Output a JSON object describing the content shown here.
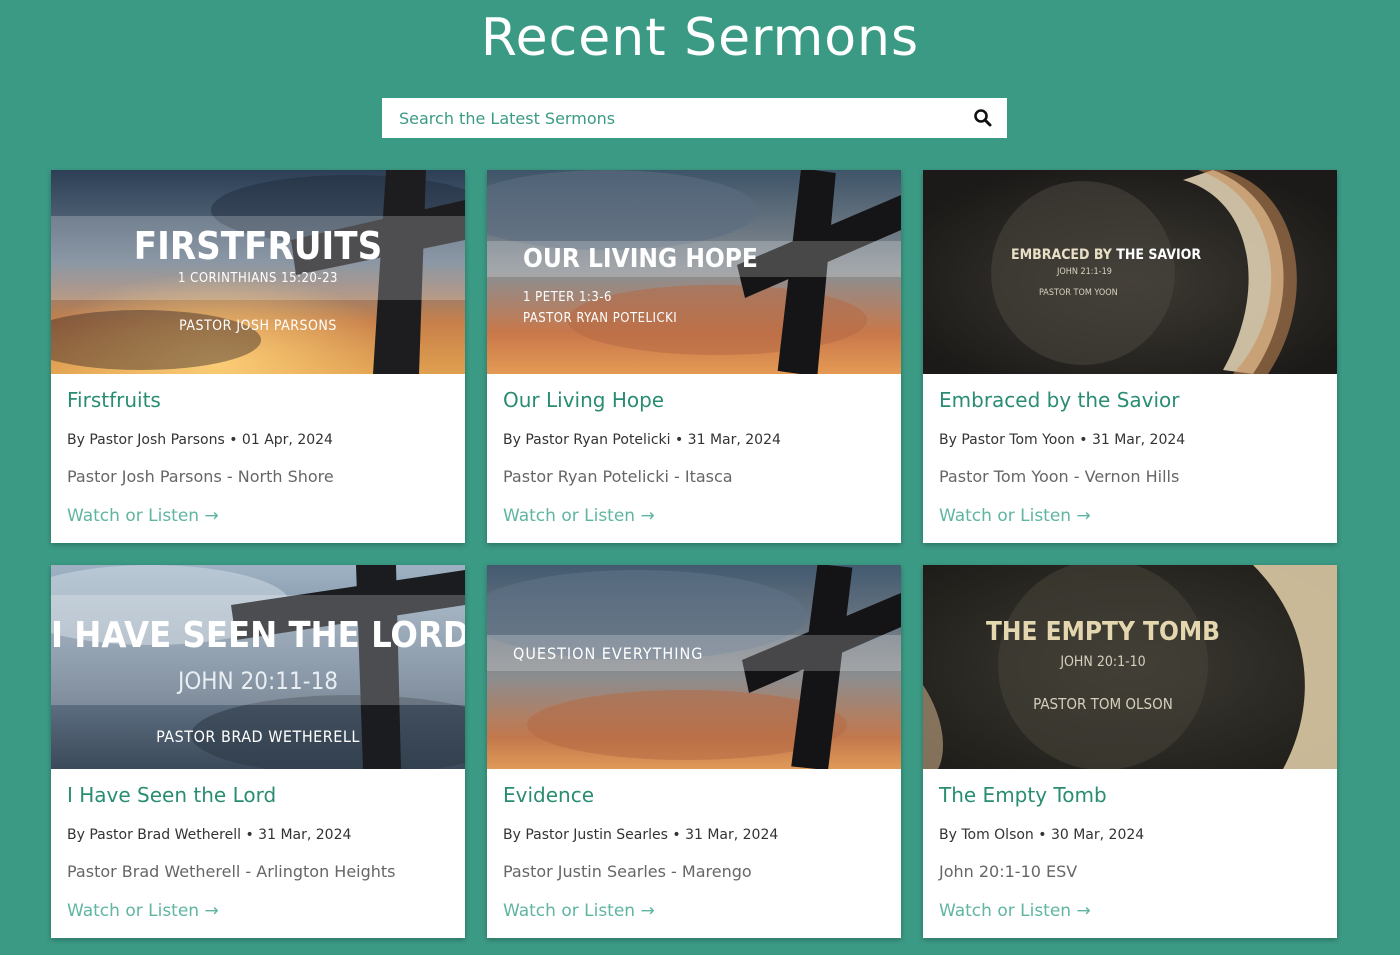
{
  "page": {
    "title": "Recent Sermons"
  },
  "search": {
    "placeholder": "Search the Latest Sermons",
    "icon": "search-icon"
  },
  "colors": {
    "background": "#3b9a84",
    "title_text": "#2a8d73",
    "link": "#5fb5a1"
  },
  "cards": [
    {
      "title": "Firstfruits",
      "meta": "By Pastor Josh Parsons • 01 Apr, 2024",
      "description": "Pastor Josh Parsons - North Shore",
      "link": "Watch or Listen →",
      "image": {
        "theme": "cross-sunset",
        "line1": "FIRSTFRUITS",
        "line2": "1 CORINTHIANS 15:20-23",
        "line3": "PASTOR JOSH PARSONS"
      }
    },
    {
      "title": "Our Living Hope",
      "meta": "By Pastor Ryan Potelicki • 31 Mar, 2024",
      "description": "Pastor Ryan Potelicki - Itasca",
      "link": "Watch or Listen →",
      "image": {
        "theme": "cross-clouds",
        "line1": "OUR LIVING HOPE",
        "line2": "1 PETER 1:3-6",
        "line3": "PASTOR RYAN POTELICKI"
      }
    },
    {
      "title": "Embraced by the Savior",
      "meta": "By Pastor Tom Yoon • 31 Mar, 2024",
      "description": "Pastor Tom Yoon - Vernon Hills",
      "link": "Watch or Listen →",
      "image": {
        "theme": "tomb-dark",
        "line1a": "EMBRACED BY",
        "line1b": "THE SAVIOR",
        "line2": "JOHN 21:1-19",
        "line3": "PASTOR TOM YOON"
      }
    },
    {
      "title": "I Have Seen the Lord",
      "meta": "By Pastor Brad Wetherell • 31 Mar, 2024",
      "description": "Pastor Brad Wetherell - Arlington Heights",
      "link": "Watch or Listen →",
      "image": {
        "theme": "cross-bluesky",
        "line1": "I HAVE SEEN THE LORD",
        "line2": "JOHN 20:11-18",
        "line3": "PASTOR BRAD WETHERELL"
      }
    },
    {
      "title": "Evidence",
      "meta": "By Pastor Justin Searles • 31 Mar, 2024",
      "description": "Pastor Justin Searles - Marengo",
      "link": "Watch or Listen →",
      "image": {
        "theme": "cross-clouds",
        "line1": "QUESTION EVERYTHING"
      }
    },
    {
      "title": "The Empty Tomb",
      "meta": "By Tom Olson • 30 Mar, 2024",
      "description": "John 20:1-10 ESV",
      "link": "Watch or Listen →",
      "image": {
        "theme": "tomb-cream",
        "line1": "THE EMPTY TOMB",
        "line2": "JOHN 20:1-10",
        "line3": "PASTOR TOM OLSON"
      }
    }
  ]
}
